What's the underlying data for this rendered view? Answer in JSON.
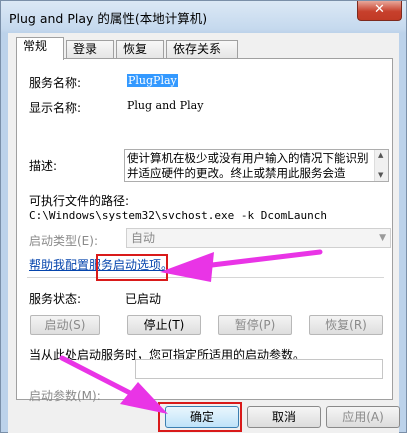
{
  "window": {
    "title": "Plug and Play 的属性(本地计算机)",
    "close_glyph": "✕"
  },
  "tabs": [
    {
      "label": "常规",
      "active": true
    },
    {
      "label": "登录",
      "active": false
    },
    {
      "label": "恢复",
      "active": false
    },
    {
      "label": "依存关系",
      "active": false
    }
  ],
  "general": {
    "service_name_label": "服务名称:",
    "service_name_value": "PlugPlay",
    "display_name_label": "显示名称:",
    "display_name_value": "Plug and Play",
    "description_label": "描述:",
    "description_value": "使计算机在极少或没有用户输入的情况下能识别并适应硬件的更改。终止或禁用此服务会造",
    "exe_path_label": "可执行文件的路径:",
    "exe_path_value": "C:\\Windows\\system32\\svchost.exe -k DcomLaunch",
    "startup_type_label": "启动类型(E):",
    "startup_type_value": "自动",
    "help_link": "帮助我配置服务启动选项。",
    "service_status_label": "服务状态:",
    "service_status_value": "已启动",
    "start_button": "启动(S)",
    "stop_button": "停止(T)",
    "pause_button": "暂停(P)",
    "resume_button": "恢复(R)",
    "start_hint": "当从此处启动服务时，您可指定所适用的启动参数。",
    "start_params_label": "启动参数(M):",
    "start_params_value": ""
  },
  "footer": {
    "ok_button": "确定",
    "cancel_button": "取消",
    "apply_button": "应用(A)"
  },
  "colors": {
    "annotation_arrow": "#e934e6",
    "annotation_box": "#d91a1a"
  }
}
